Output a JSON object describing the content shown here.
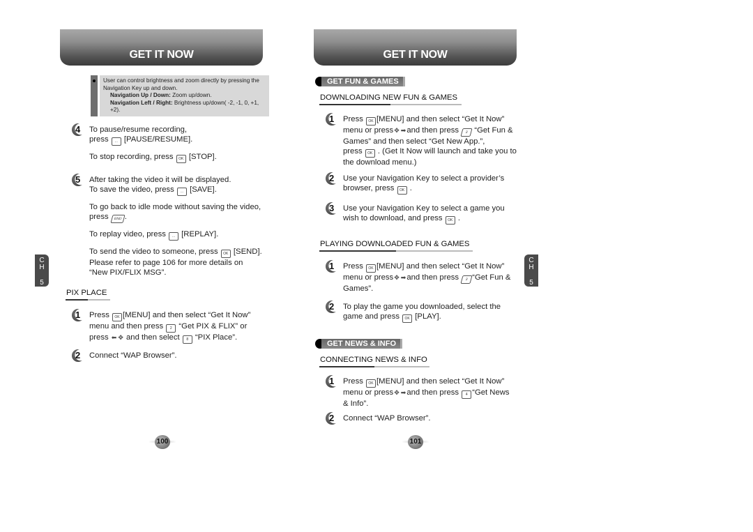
{
  "left_page": {
    "banner_title": "GET IT NOW",
    "note": {
      "intro": "User can control brightness and zoom directly by pressing the Navigation Key up and down.",
      "line1_label": "Navigation Up / Down:",
      "line1_text": " Zoom up/down.",
      "line2_label": "Navigation Left / Right:",
      "line2_text": " Brightness up/down( -2, -1, 0, +1, +2)."
    },
    "step4": {
      "num": "4",
      "l1": "To pause/resume recording,",
      "l2a": "press",
      "l2b": "[PAUSE/RESUME].",
      "l3a": "To stop recording, press",
      "l3b": "[STOP]."
    },
    "step5": {
      "num": "5",
      "l1": "After taking the video it will be displayed.",
      "l2a": "To save the video, press",
      "l2b": "[SAVE].",
      "l3": "To go back to idle mode without saving the video,",
      "l4a": "press",
      "l4b": ".",
      "l5a": "To replay video, press",
      "l5b": "[REPLAY].",
      "l6a": "To send the video to someone, press",
      "l6b": "[SEND].",
      "l7": "Please refer to page 106 for more details on",
      "l8": "“New PIX/FLIX MSG”."
    },
    "pix_place": {
      "heading": "PIX PLACE",
      "step1": {
        "num": "1",
        "l1a": "Press",
        "l1b": "[MENU] and then select “Get It Now”",
        "l2a": "menu and then press",
        "l2b": "“Get PIX & FLIX” or",
        "l3a": "press",
        "l3b": "and then select",
        "l3c": "“PIX Place”."
      },
      "step2": {
        "num": "2",
        "text": "Connect “WAP Browser”."
      }
    },
    "chapter_tab": {
      "c": "C",
      "h": "H",
      "n": "5"
    },
    "page_number": "100"
  },
  "right_page": {
    "banner_title": "GET IT NOW",
    "fun_games": {
      "pill": "GET FUN & GAMES",
      "downloading": {
        "heading": "DOWNLOADING NEW FUN & GAMES",
        "step1": {
          "num": "1",
          "l1a": "Press",
          "l1b": "[MENU] and then select “Get It Now”",
          "l2a": "menu or press",
          "l2b": "and then press",
          "l2c": "“Get Fun &",
          "l3": "Games” and then select “Get New App.”,",
          "l4a": "press",
          "l4b": ". (Get It Now will launch and take you to",
          "l5": "the download menu.)"
        },
        "step2": {
          "num": "2",
          "l1": "Use your Navigation Key to select a provider’s",
          "l2a": "browser, press",
          "l2b": "."
        },
        "step3": {
          "num": "3",
          "l1": "Use your Navigation Key to select a game you",
          "l2a": "wish to download, and press",
          "l2b": "."
        }
      },
      "playing": {
        "heading": "PLAYING DOWNLOADED FUN & GAMES",
        "step1": {
          "num": "1",
          "l1a": "Press",
          "l1b": "[MENU] and then select “Get It Now”",
          "l2a": "menu or press",
          "l2b": "and then press",
          "l2c": "“Get Fun &",
          "l3": "Games”."
        },
        "step2": {
          "num": "2",
          "l1": "To play the game you downloaded, select the",
          "l2a": "game and press",
          "l2b": "[PLAY]."
        }
      }
    },
    "news_info": {
      "pill": "GET NEWS & INFO",
      "connecting": {
        "heading": "CONNECTING NEWS & INFO",
        "step1": {
          "num": "1",
          "l1a": "Press",
          "l1b": "[MENU] and then select “Get It Now”",
          "l2a": "menu or press",
          "l2b": "and then press",
          "l2c": "“Get News",
          "l3": "& Info”."
        },
        "step2": {
          "num": "2",
          "text": "Connect “WAP Browser”."
        }
      }
    },
    "chapter_tab": {
      "c": "C",
      "h": "H",
      "n": "5"
    },
    "page_number": "101"
  },
  "keys": {
    "ok": "OK",
    "soft": "…",
    "end": "END",
    "k2": "2",
    "k3": "3",
    "k4": "4",
    "k8": "8",
    "nav": "✥",
    "arrow_left": "⬅",
    "arrow_right": "➡"
  }
}
